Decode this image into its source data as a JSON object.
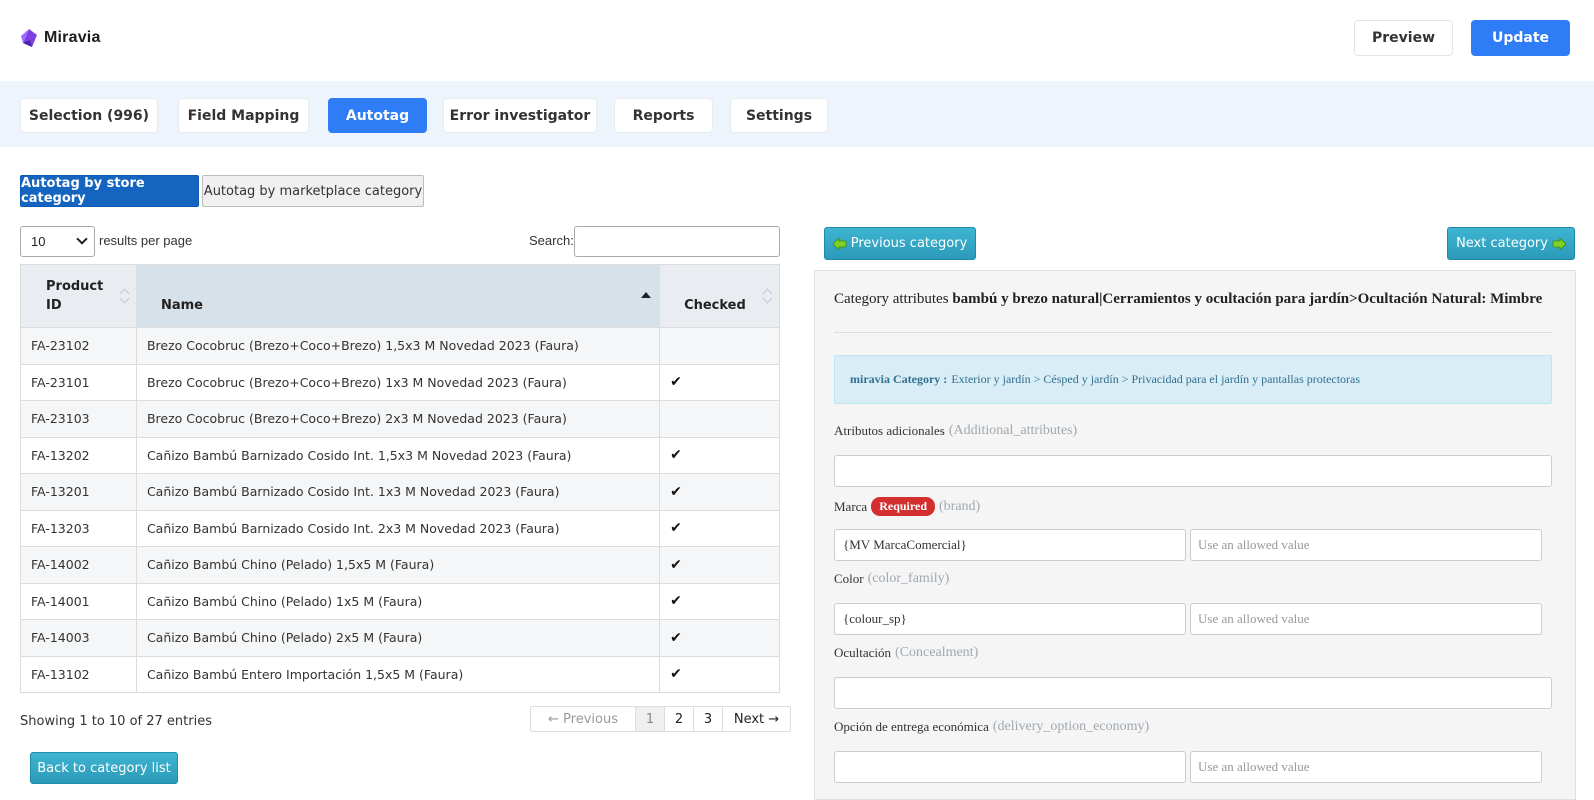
{
  "brand": {
    "name": "Miravia",
    "accent": "#2f7df6"
  },
  "header": {
    "preview_label": "Preview",
    "update_label": "Update"
  },
  "tabs": [
    {
      "label": "Selection (996)",
      "active": false
    },
    {
      "label": "Field Mapping",
      "active": false
    },
    {
      "label": "Autotag",
      "active": true
    },
    {
      "label": "Error investigator",
      "active": false
    },
    {
      "label": "Reports",
      "active": false
    },
    {
      "label": "Settings",
      "active": false
    }
  ],
  "autotag_modes": {
    "by_store": "Autotag by store category",
    "by_marketplace": "Autotag by marketplace category"
  },
  "table_controls": {
    "page_length": "10",
    "results_label": "results per page",
    "search_label": "Search:",
    "search_value": ""
  },
  "table": {
    "headers": {
      "id": "Product ID",
      "name": "Name",
      "checked": "Checked"
    },
    "rows": [
      {
        "id": "FA-23102",
        "name": "Brezo Cocobruc (Brezo+Coco+Brezo) 1,5x3 M Novedad 2023 (Faura)",
        "checked": ""
      },
      {
        "id": "FA-23101",
        "name": "Brezo Cocobruc (Brezo+Coco+Brezo) 1x3 M Novedad 2023 (Faura)",
        "checked": "✔"
      },
      {
        "id": "FA-23103",
        "name": "Brezo Cocobruc (Brezo+Coco+Brezo) 2x3 M Novedad 2023 (Faura)",
        "checked": ""
      },
      {
        "id": "FA-13202",
        "name": "Cañizo Bambú Barnizado Cosido Int. 1,5x3 M Novedad 2023 (Faura)",
        "checked": "✔"
      },
      {
        "id": "FA-13201",
        "name": "Cañizo Bambú Barnizado Cosido Int. 1x3 M Novedad 2023 (Faura)",
        "checked": "✔"
      },
      {
        "id": "FA-13203",
        "name": "Cañizo Bambú Barnizado Cosido Int. 2x3 M Novedad 2023 (Faura)",
        "checked": "✔"
      },
      {
        "id": "FA-14002",
        "name": "Cañizo Bambú Chino (Pelado) 1,5x5 M (Faura)",
        "checked": "✔"
      },
      {
        "id": "FA-14001",
        "name": "Cañizo Bambú Chino (Pelado) 1x5 M (Faura)",
        "checked": "✔"
      },
      {
        "id": "FA-14003",
        "name": "Cañizo Bambú Chino (Pelado) 2x5 M (Faura)",
        "checked": "✔"
      },
      {
        "id": "FA-13102",
        "name": "Cañizo Bambú Entero Importación 1,5x5 M (Faura)",
        "checked": "✔"
      }
    ]
  },
  "footer": {
    "showing": "Showing 1 to 10 of 27 entries",
    "pager": {
      "prev": "← Previous",
      "pages": [
        "1",
        "2",
        "3"
      ],
      "current": "1",
      "next": "Next →"
    },
    "back_label": "Back to category list"
  },
  "category_nav": {
    "prev_label": "Previous category",
    "next_label": "Next category"
  },
  "panel": {
    "title_prefix": "Category attributes",
    "title_bold": "bambú y brezo natural|Cerramientos y ocultación para jardín>Ocultación Natural: Mimbre",
    "category_label": "miravia Category :",
    "category_value": "Exterior y jardín > Césped y jardín > Privacidad para el jardín y pantallas protectoras",
    "required_badge": "Required",
    "fields": [
      {
        "label": "Atributos adicionales",
        "code": "(Additional_attributes)",
        "value": ""
      },
      {
        "label": "Marca",
        "code": "(brand)",
        "value": "{MV MarcaComercial}",
        "allowed_placeholder": "Use an allowed value",
        "required": true
      },
      {
        "label": "Color",
        "code": "(color_family)",
        "value": "{colour_sp}",
        "allowed_placeholder": "Use an allowed value"
      },
      {
        "label": "Ocultación",
        "code": "(Concealment)",
        "value": ""
      },
      {
        "label": "Opción de entrega económica",
        "code": "(delivery_option_economy)",
        "value": "",
        "allowed_placeholder": "Use an allowed value"
      }
    ]
  }
}
